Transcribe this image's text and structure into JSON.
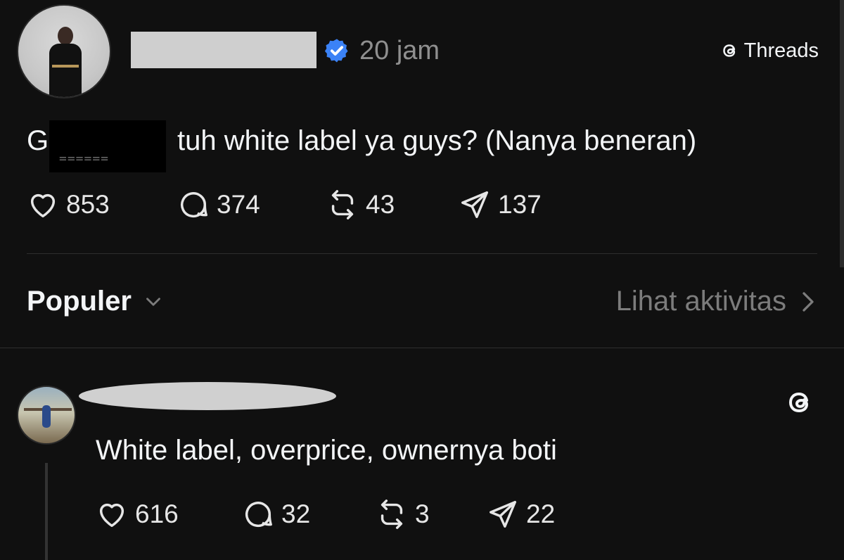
{
  "post": {
    "time": "20 jam",
    "brand_label": "Threads",
    "text_prefix": "G",
    "text_redacted_mask": "======",
    "text_rest": "tuh white label ya guys? (Nanya beneran)",
    "likes": "853",
    "comments": "374",
    "reposts": "43",
    "shares": "137"
  },
  "section": {
    "sort_label": "Populer",
    "activity_label": "Lihat aktivitas"
  },
  "reply": {
    "text": "White label, overprice, ownernya boti",
    "likes": "616",
    "comments": "32",
    "reposts": "3",
    "shares": "22"
  },
  "colors": {
    "background": "#101010",
    "text": "#f3f5f7",
    "muted": "#8f8f8f",
    "verified": "#3b82f6"
  }
}
